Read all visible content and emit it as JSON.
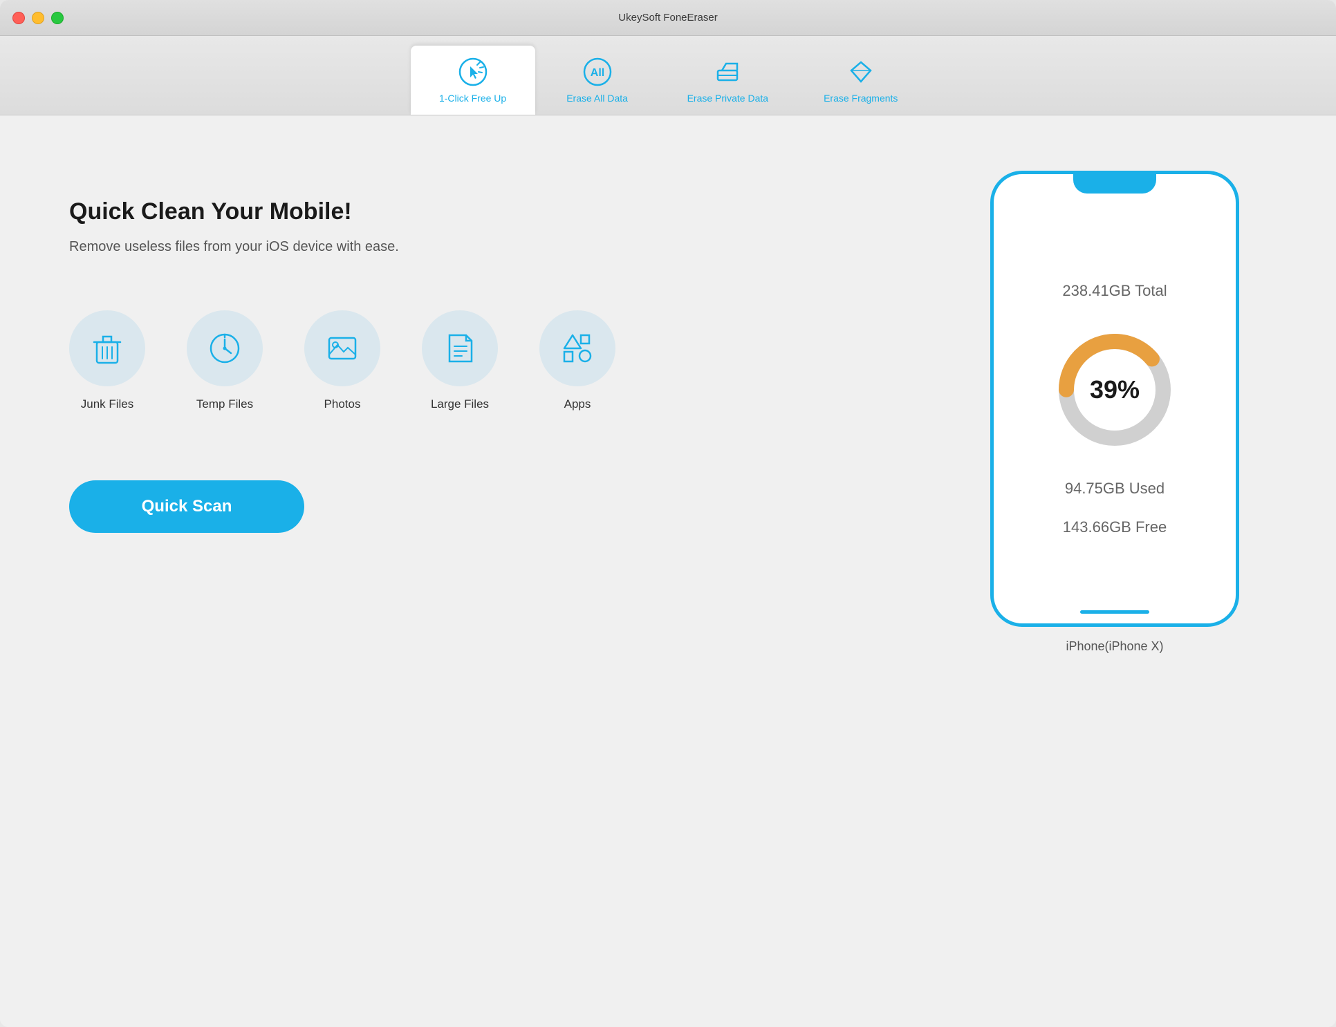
{
  "window": {
    "title": "UkeySoft FoneEraser"
  },
  "tabs": [
    {
      "id": "one-click",
      "label": "1-Click Free Up",
      "active": true
    },
    {
      "id": "erase-all",
      "label": "Erase All Data",
      "active": false
    },
    {
      "id": "erase-private",
      "label": "Erase Private Data",
      "active": false
    },
    {
      "id": "erase-fragments",
      "label": "Erase Fragments",
      "active": false
    }
  ],
  "main": {
    "headline": "Quick Clean Your Mobile!",
    "subtext": "Remove useless files from your iOS device with ease.",
    "features": [
      {
        "id": "junk-files",
        "label": "Junk Files"
      },
      {
        "id": "temp-files",
        "label": "Temp Files"
      },
      {
        "id": "photos",
        "label": "Photos"
      },
      {
        "id": "large-files",
        "label": "Large Files"
      },
      {
        "id": "apps",
        "label": "Apps"
      }
    ],
    "scan_button_label": "Quick Scan"
  },
  "device": {
    "total": "238.41GB Total",
    "used": "94.75GB Used",
    "free": "143.66GB Free",
    "usage_percent": "39%",
    "usage_value": 39,
    "name": "iPhone(iPhone X)"
  },
  "colors": {
    "accent": "#1ab0e8",
    "used_color": "#e8a040",
    "free_color": "#d0d0d0"
  }
}
